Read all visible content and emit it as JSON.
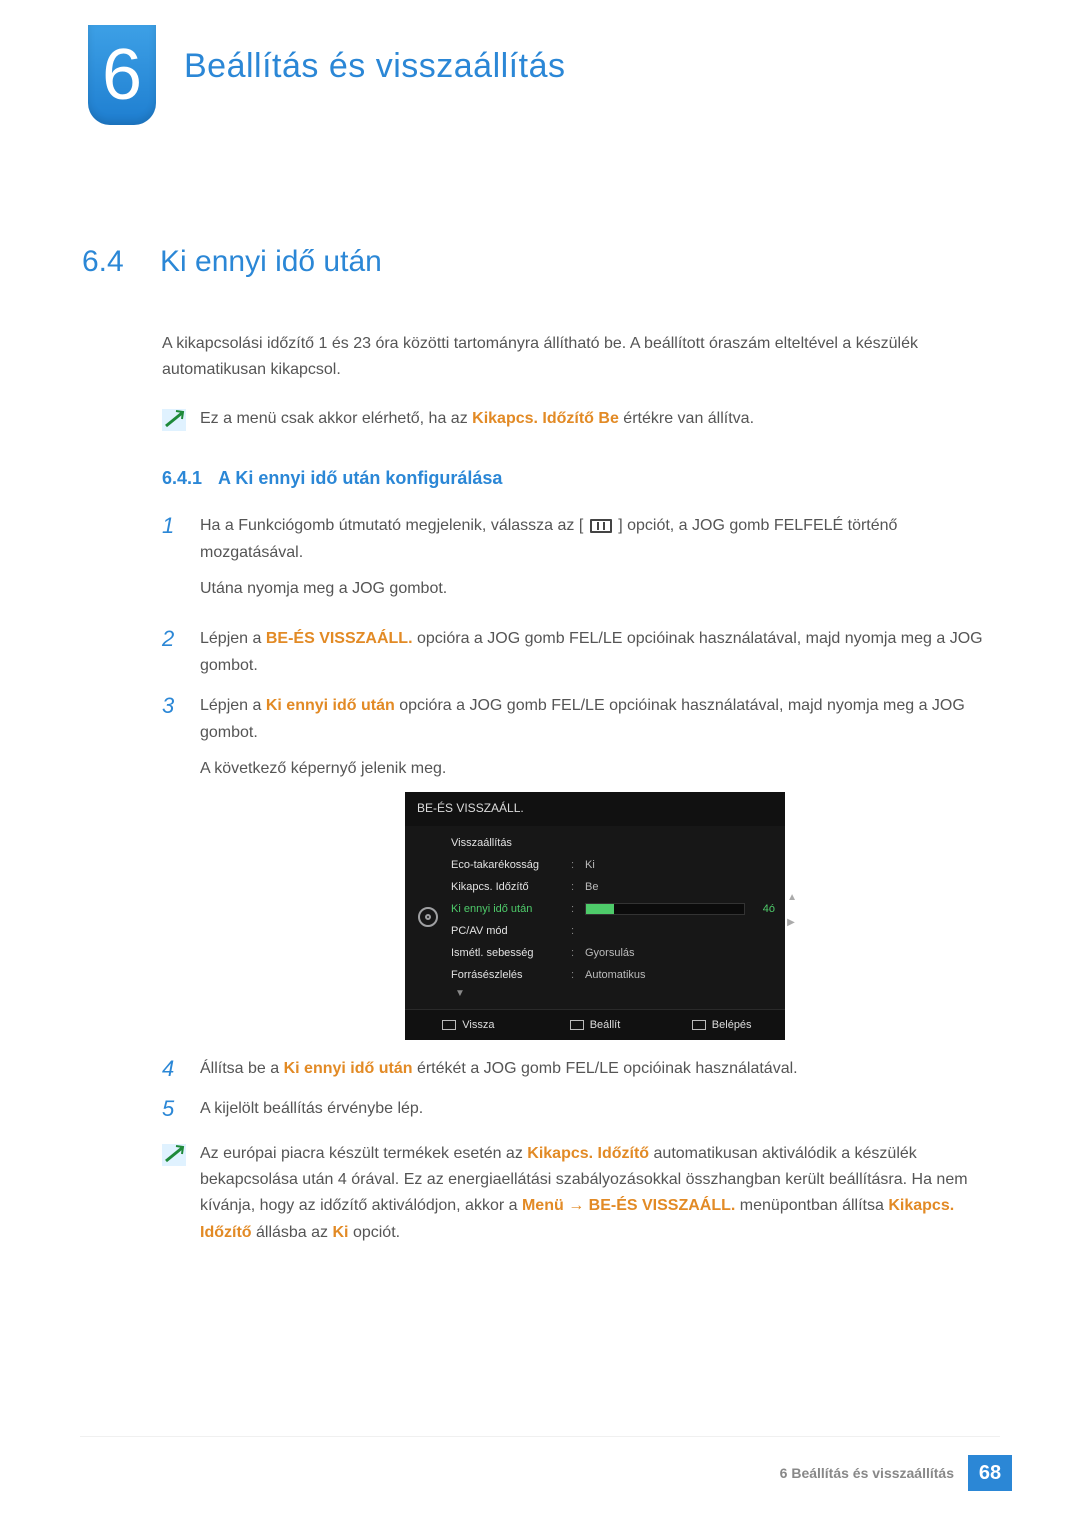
{
  "chapter": {
    "num": "6",
    "title": "Beállítás és visszaállítás"
  },
  "section": {
    "num": "6.4",
    "title": "Ki ennyi idő után"
  },
  "intro": "A kikapcsolási időzítő 1 és 23 óra közötti tartományra állítható be. A beállított óraszám elteltével a készülék automatikusan kikapcsol.",
  "note1": {
    "pre": "Ez a menü csak akkor elérhető, ha az ",
    "strong": "Kikapcs. Időzítő Be",
    "post": " értékre van állítva."
  },
  "subsection": {
    "num": "6.4.1",
    "title": "A Ki ennyi idő után konfigurálása"
  },
  "steps": [
    {
      "num": "1",
      "p1_pre": "Ha a Funkciógomb útmutató megjelenik, válassza az [",
      "p1_post": "] opciót, a JOG gomb FELFELÉ történő mozgatásával.",
      "p2": "Utána nyomja meg a JOG gombot."
    },
    {
      "num": "2",
      "pre": "Lépjen a ",
      "strong": "BE-ÉS VISSZAÁLL.",
      "post": " opcióra a JOG gomb FEL/LE opcióinak használatával, majd nyomja meg a JOG gombot."
    },
    {
      "num": "3",
      "pre": "Lépjen a ",
      "strong": "Ki ennyi idő után",
      "post": " opcióra a JOG gomb FEL/LE opcióinak használatával, majd nyomja meg a JOG gombot.",
      "p2": "A következő képernyő jelenik meg."
    },
    {
      "num": "4",
      "pre": "Állítsa be a ",
      "strong": "Ki ennyi idő után",
      "post": " értékét a JOG gomb FEL/LE opcióinak használatával."
    },
    {
      "num": "5",
      "text": "A kijelölt beállítás érvénybe lép."
    }
  ],
  "osd": {
    "title": "BE-ÉS VISSZAÁLL.",
    "rows": [
      {
        "label": "Visszaállítás",
        "value": ""
      },
      {
        "label": "Eco-takarékosság",
        "value": "Ki"
      },
      {
        "label": "Kikapcs. Időzítő",
        "value": "Be"
      },
      {
        "label": "Ki ennyi idő után",
        "selected": true,
        "slider": "4ó"
      },
      {
        "label": "PC/AV mód",
        "value": ""
      },
      {
        "label": "Ismétl. sebesség",
        "value": "Gyorsulás"
      },
      {
        "label": "Forrásészlelés",
        "value": "Automatikus"
      }
    ],
    "foot": {
      "back": "Vissza",
      "set": "Beállít",
      "enter": "Belépés"
    }
  },
  "note2": {
    "pre": "Az európai piacra készült termékek esetén az ",
    "s1": "Kikapcs. Időzítő",
    "mid1": " automatikusan aktiválódik a készülék bekapcsolása után 4 órával. Ez az energiaellátási szabályozásokkal összhangban került beállításra. Ha nem kívánja, hogy az időzítő aktiválódjon, akkor a ",
    "s2": "Menü",
    "arrow": " → ",
    "s3": "BE-ÉS VISSZAÁLL.",
    "mid2": " menüpontban állítsa ",
    "s4": "Kikapcs. Időzítő",
    "mid3": " állásba az ",
    "s5": "Ki",
    "post": " opciót."
  },
  "footer": {
    "text": "6 Beállítás és visszaállítás",
    "page": "68"
  }
}
